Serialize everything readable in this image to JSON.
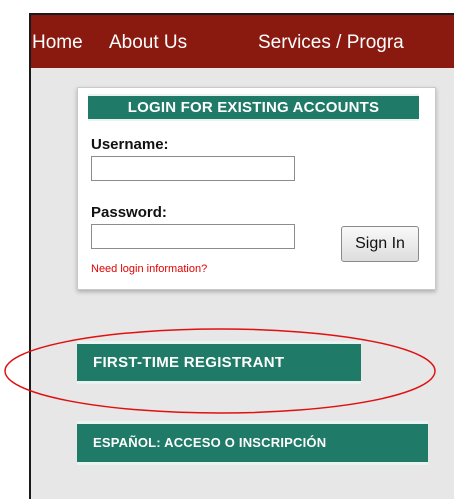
{
  "nav": {
    "items": [
      "Home",
      "About Us",
      "Services / Progra"
    ]
  },
  "login": {
    "heading": "LOGIN FOR EXISTING ACCOUNTS",
    "username_label": "Username:",
    "username_value": "",
    "password_label": "Password:",
    "password_value": "",
    "sign_in_label": "Sign In",
    "help_link": "Need login information?"
  },
  "actions": {
    "first_time": "FIRST-TIME REGISTRANT",
    "espanol": "ESPAÑOL: ACCESO O INSCRIPCIÓN"
  },
  "colors": {
    "nav_bg": "#8a1a10",
    "accent_green": "#1f7a68",
    "link_red": "#e00000",
    "annotation_red": "#e01010"
  }
}
